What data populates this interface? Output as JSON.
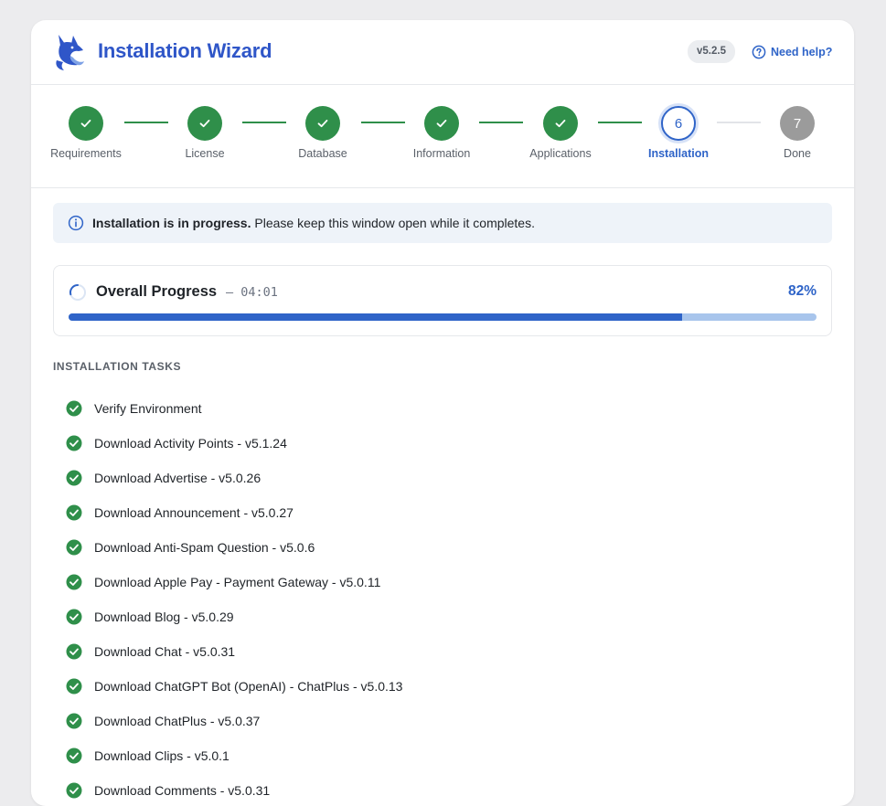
{
  "header": {
    "title": "Installation Wizard",
    "version": "v5.2.5",
    "help_label": "Need help?",
    "logo_icon": "fox-logo"
  },
  "colors": {
    "brand": "#2f56c8",
    "accent": "#2f64c8",
    "success": "#2f8f4a",
    "pending": "#9b9b9b"
  },
  "steps": [
    {
      "number": "1",
      "label": "Requirements",
      "state": "done"
    },
    {
      "number": "2",
      "label": "License",
      "state": "done"
    },
    {
      "number": "3",
      "label": "Database",
      "state": "done"
    },
    {
      "number": "4",
      "label": "Information",
      "state": "done"
    },
    {
      "number": "5",
      "label": "Applications",
      "state": "done"
    },
    {
      "number": "6",
      "label": "Installation",
      "state": "active"
    },
    {
      "number": "7",
      "label": "Done",
      "state": "pending"
    }
  ],
  "alert": {
    "icon": "info-icon",
    "bold_text": "Installation is in progress.",
    "text": " Please keep this window open while it completes."
  },
  "progress": {
    "title": "Overall Progress",
    "elapsed": "– 04:01",
    "percent_label": "82%",
    "value": 0.82
  },
  "tasks_heading": "INSTALLATION TASKS",
  "tasks": [
    {
      "label": "Verify Environment",
      "status": "done"
    },
    {
      "label": "Download Activity Points - v5.1.24",
      "status": "done"
    },
    {
      "label": "Download Advertise - v5.0.26",
      "status": "done"
    },
    {
      "label": "Download Announcement - v5.0.27",
      "status": "done"
    },
    {
      "label": "Download Anti-Spam Question - v5.0.6",
      "status": "done"
    },
    {
      "label": "Download Apple Pay - Payment Gateway - v5.0.11",
      "status": "done"
    },
    {
      "label": "Download Blog - v5.0.29",
      "status": "done"
    },
    {
      "label": "Download Chat - v5.0.31",
      "status": "done"
    },
    {
      "label": "Download ChatGPT Bot (OpenAI) - ChatPlus - v5.0.13",
      "status": "done"
    },
    {
      "label": "Download ChatPlus - v5.0.37",
      "status": "done"
    },
    {
      "label": "Download Clips - v5.0.1",
      "status": "done"
    },
    {
      "label": "Download Comments - v5.0.31",
      "status": "done"
    }
  ]
}
